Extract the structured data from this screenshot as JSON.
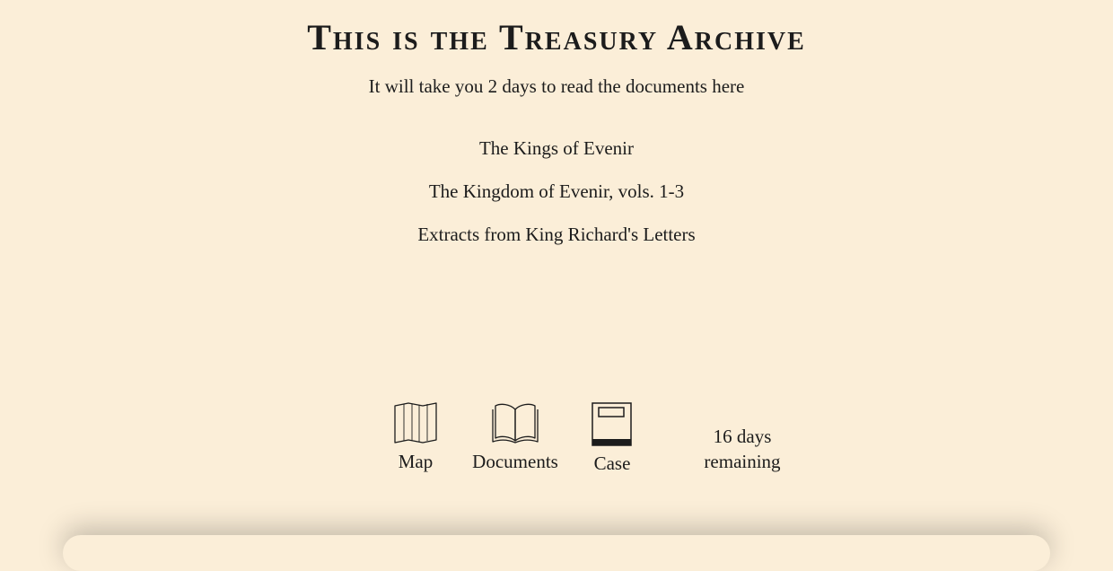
{
  "header": {
    "title": "This is the Treasury Archive",
    "subtitle": "It will take you 2 days to read the documents here"
  },
  "documents": [
    "The Kings of Evenir",
    "The Kingdom of Evenir, vols. 1-3",
    "Extracts from King Richard's Letters"
  ],
  "toolbar": {
    "map_label": "Map",
    "map_icon": "map-icon",
    "documents_label": "Documents",
    "documents_icon": "open-book-icon",
    "case_label": "Case",
    "case_icon": "case-box-icon",
    "days_count": "16 days",
    "days_suffix": "remaining"
  },
  "colors": {
    "background": "#fbeed8",
    "text": "#1c1c1c"
  }
}
